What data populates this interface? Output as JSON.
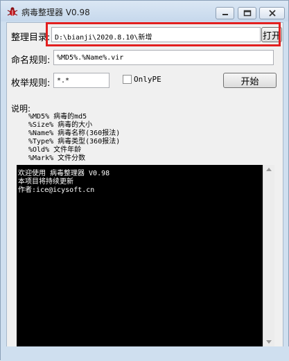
{
  "window": {
    "title": "病毒整理器 V0.98",
    "accent_color": "#e21f1f",
    "icon": "bug-icon"
  },
  "form": {
    "dir_label": "整理目录:",
    "dir_value": "D:\\bianji\\2020.8.10\\新增",
    "open_button": "打开",
    "naming_label": "命名规则:",
    "naming_value": "%MD5%.%Name%.vir",
    "enum_label": "枚举规则:",
    "enum_value": "*.*",
    "onlype_label": "OnlyPE",
    "start_button": "开始"
  },
  "help": {
    "title": "说明:",
    "lines": [
      "%MD5%  病毒的md5",
      "%Size% 病毒的大小",
      "%Name% 病毒名称(360报法)",
      "%Type% 病毒类型(360报法)",
      "%Old%  文件年龄",
      "%Mark% 文件分数"
    ]
  },
  "console": {
    "lines": [
      "欢迎使用 病毒整理器 V0.98",
      "本项目将持续更新",
      "作者:ice@icysoft.cn"
    ]
  }
}
